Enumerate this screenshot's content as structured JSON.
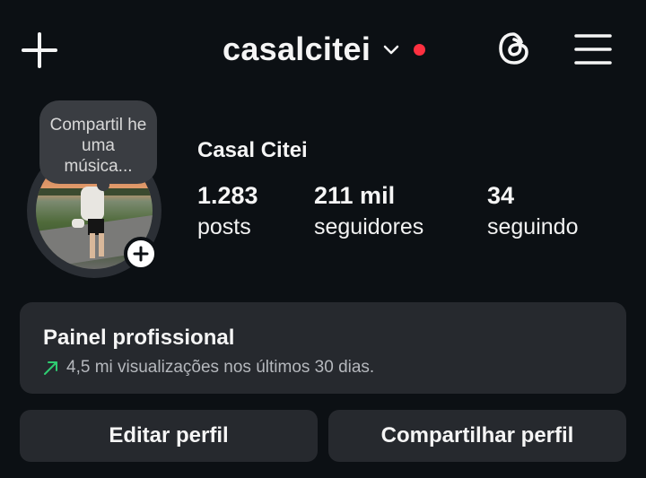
{
  "header": {
    "username": "casalcitei",
    "create_icon": "plus-icon",
    "threads_icon": "threads-icon",
    "menu_icon": "hamburger-menu-icon",
    "notification_dot_color": "#ff3040"
  },
  "profile": {
    "note_text": "Compartil he uma música...",
    "display_name": "Casal Citei",
    "stats": [
      {
        "value": "1.283",
        "label": "posts"
      },
      {
        "value": "211 mil",
        "label": "seguidores"
      },
      {
        "value": "34",
        "label": "seguindo"
      }
    ]
  },
  "dashboard": {
    "title": "Painel profissional",
    "subtitle": "4,5 mi visualizações nos últimos 30 dias.",
    "trend_color": "#2ecc71"
  },
  "actions": {
    "edit_label": "Editar perfil",
    "share_label": "Compartilhar perfil"
  },
  "colors": {
    "background": "#0c1014",
    "card": "#26292e",
    "text": "#f5f5f5",
    "muted": "#b5b8bd"
  }
}
